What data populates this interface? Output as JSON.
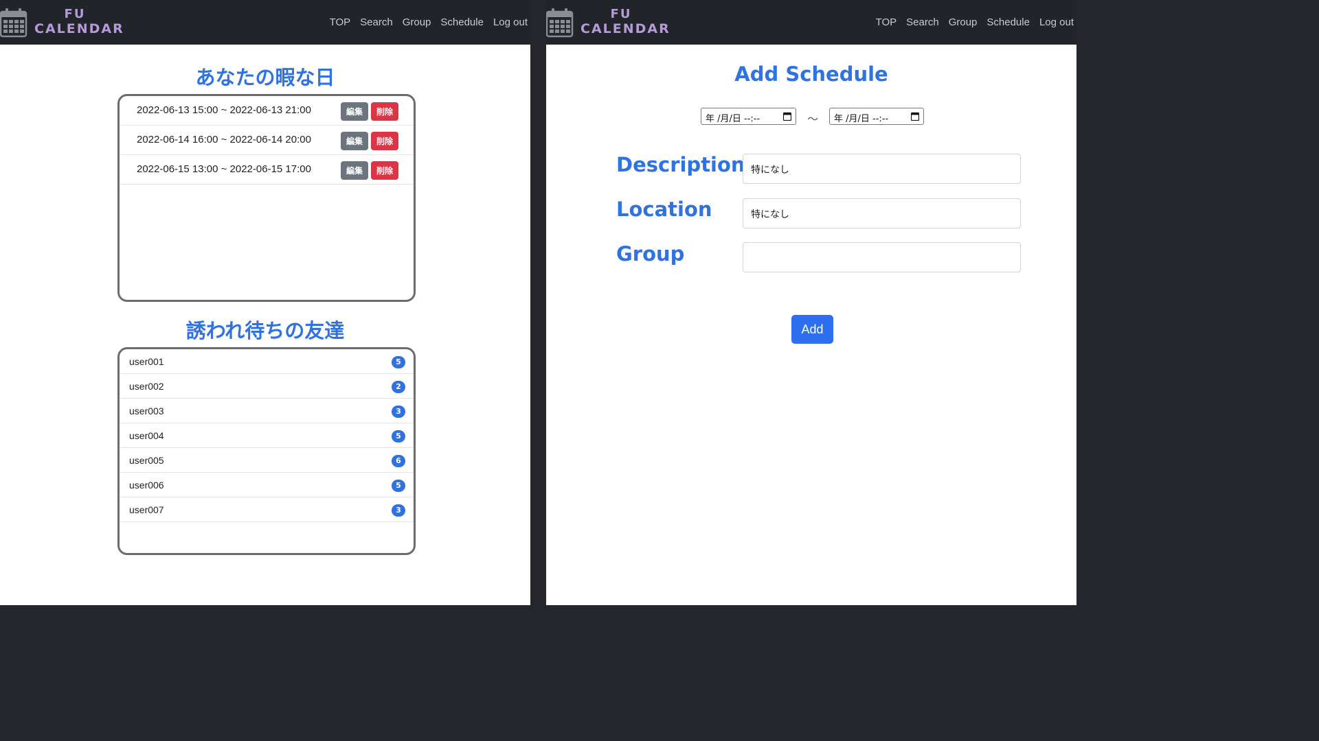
{
  "brand": {
    "line1": "FU",
    "line2": "CALENDAR"
  },
  "nav": [
    "TOP",
    "Search",
    "Group",
    "Schedule",
    "Log out"
  ],
  "left": {
    "free_days_title": "あなたの暇な日",
    "free_days": [
      "2022-06-13 15:00 ~ 2022-06-13 21:00",
      "2022-06-14 16:00 ~ 2022-06-14 20:00",
      "2022-06-15 13:00 ~ 2022-06-15 17:00"
    ],
    "edit_label": "編集",
    "delete_label": "削除",
    "friends_title": "誘われ待ちの友達",
    "friends": [
      {
        "name": "user001",
        "count": "5"
      },
      {
        "name": "user002",
        "count": "2"
      },
      {
        "name": "user003",
        "count": "3"
      },
      {
        "name": "user004",
        "count": "5"
      },
      {
        "name": "user005",
        "count": "6"
      },
      {
        "name": "user006",
        "count": "5"
      },
      {
        "name": "user007",
        "count": "3"
      }
    ]
  },
  "right": {
    "title": "Add Schedule",
    "start_date": "年 /月/日 --:--",
    "end_date": "年 /月/日 --:--",
    "tilde": "〜",
    "description_label": "Description",
    "description_value": "特になし",
    "location_label": "Location",
    "location_value": "特になし",
    "group_label": "Group",
    "group_value": "",
    "add_label": "Add"
  },
  "colors": {
    "accent": "#2f72e0",
    "navbar": "#212529",
    "brand": "#b79ad9",
    "danger": "#dc3545",
    "secondary": "#6c757d"
  }
}
